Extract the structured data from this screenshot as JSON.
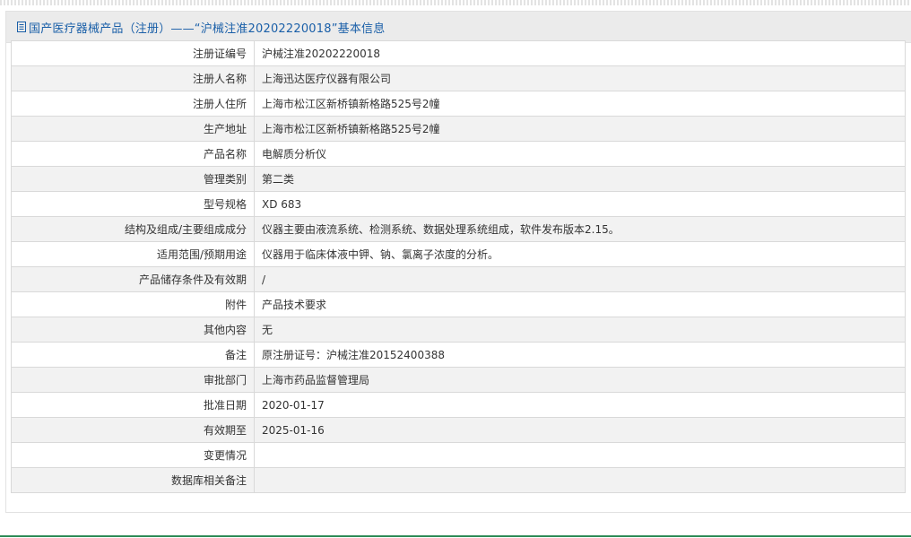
{
  "header": {
    "title": "国产医疗器械产品（注册）——“沪械注准20202220018”基本信息",
    "icon": "document-icon",
    "color": "#1a5fa8"
  },
  "rows": [
    {
      "label": "注册证编号",
      "value": "沪械注准20202220018"
    },
    {
      "label": "注册人名称",
      "value": "上海迅达医疗仪器有限公司"
    },
    {
      "label": "注册人住所",
      "value": "上海市松江区新桥镇新格路525号2幢"
    },
    {
      "label": "生产地址",
      "value": "上海市松江区新桥镇新格路525号2幢"
    },
    {
      "label": "产品名称",
      "value": "电解质分析仪"
    },
    {
      "label": "管理类别",
      "value": "第二类"
    },
    {
      "label": "型号规格",
      "value": "XD 683"
    },
    {
      "label": "结构及组成/主要组成成分",
      "value": "仪器主要由液流系统、检测系统、数据处理系统组成，软件发布版本2.15。"
    },
    {
      "label": "适用范围/预期用途",
      "value": "仪器用于临床体液中钾、钠、氯离子浓度的分析。"
    },
    {
      "label": "产品储存条件及有效期",
      "value": "/"
    },
    {
      "label": "附件",
      "value": "产品技术要求"
    },
    {
      "label": "其他内容",
      "value": "无"
    },
    {
      "label": "备注",
      "value": "原注册证号：沪械注准20152400388"
    },
    {
      "label": "审批部门",
      "value": "上海市药品监督管理局"
    },
    {
      "label": "批准日期",
      "value": "2020-01-17"
    },
    {
      "label": "有效期至",
      "value": "2025-01-16"
    },
    {
      "label": "变更情况",
      "value": ""
    },
    {
      "label": "数据库相关备注",
      "value": ""
    }
  ]
}
